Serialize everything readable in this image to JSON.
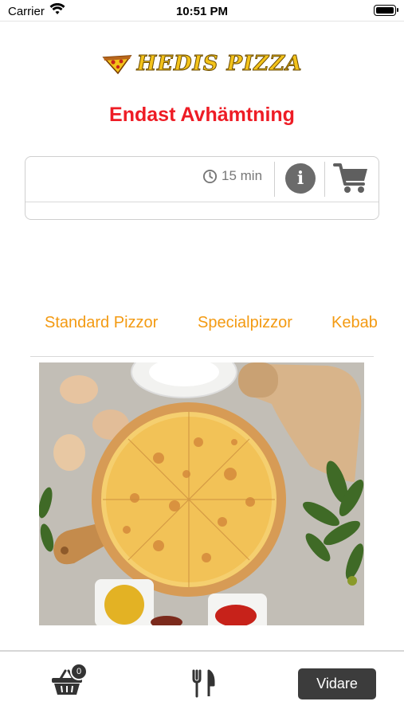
{
  "status_bar": {
    "carrier": "Carrier",
    "time": "10:51 PM"
  },
  "header": {
    "logo_text": "HEDIS PIZZA",
    "subtitle": "Endast Avhämtning"
  },
  "info_card": {
    "eta_text": "15 min",
    "icons": [
      "clock-icon",
      "info-icon",
      "cart-icon"
    ]
  },
  "categories": [
    {
      "label": "Standard Pizzor"
    },
    {
      "label": "Specialpizzor"
    },
    {
      "label": "Kebab"
    }
  ],
  "hero": {
    "icon": "pizza-photo"
  },
  "bottom_bar": {
    "basket_count": "0",
    "next_label": "Vidare",
    "icons": [
      "basket-icon",
      "utensils-icon"
    ]
  },
  "colors": {
    "accent_red": "#ee1c25",
    "tab_orange": "#f39a12",
    "logo_yellow": "#f3c31a",
    "dark_button": "#3c3c3c"
  }
}
